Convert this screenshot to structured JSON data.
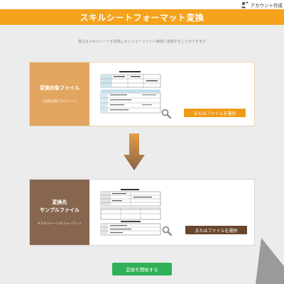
{
  "top": {
    "account_label": "アカウント作成"
  },
  "header": {
    "title": "スキルシートフォーマット変換"
  },
  "subtitle": "異なるスキルシートを変換したいフォーマットへ簡単に変換することができます",
  "source": {
    "title": "変換対象ファイル",
    "description": "※変換対象スキルシート",
    "select_label": "またはファイルを選択"
  },
  "target": {
    "title_line1": "変換先",
    "title_line2": "サンプルファイル",
    "description": "※スキルシートのフォーマット",
    "select_label": "またはファイルを選択"
  },
  "start_label": "変換を開始する",
  "colors": {
    "header_orange": "#f5a21c",
    "source_panel": "#e3a661",
    "target_panel": "#86664f",
    "start_green": "#2fb157"
  },
  "icons": [
    "account-icon",
    "magnifier-icon",
    "down-arrow-icon"
  ]
}
